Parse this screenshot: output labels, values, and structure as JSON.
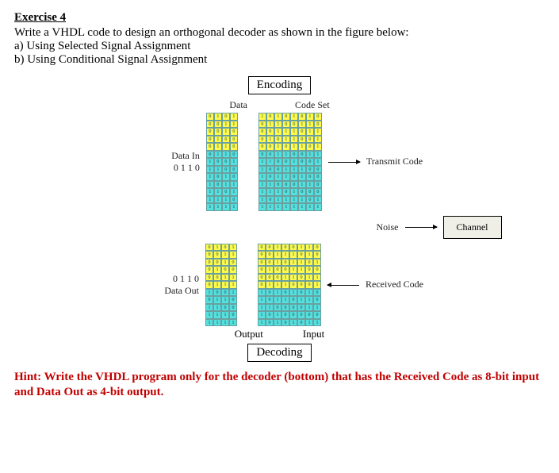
{
  "title": "Exercise 4",
  "prompt": "Write a VHDL code to design an orthogonal decoder as shown in the figure below:",
  "part_a": "a) Using Selected Signal Assignment",
  "part_b": "b) Using Conditional Signal Assignment",
  "figure": {
    "encoding_label": "Encoding",
    "decoding_label": "Decoding",
    "data_header": "Data",
    "codeset_header": "Code Set",
    "data_in_label": "Data In",
    "data_in_value": "0 1 1 0",
    "transmit_label": "Transmit Code",
    "noise_label": "Noise",
    "channel_label": "Channel",
    "data_out_value": "0 1 1 0",
    "data_out_label": "Data Out",
    "received_label": "Received Code",
    "output_label": "Output",
    "input_label": "Input"
  },
  "hint": "Hint: Write the VHDL program only for the decoder (bottom) that has the Received Code as 8-bit input and Data Out as 4-bit output.",
  "encoder": {
    "data_rows": [
      [
        "0",
        "1",
        "0",
        "1"
      ],
      [
        "0",
        "0",
        "1",
        "1"
      ],
      [
        "0",
        "0",
        "1",
        "0"
      ],
      [
        "0",
        "1",
        "0",
        "0"
      ],
      [
        "0",
        "1",
        "1",
        "0"
      ],
      [
        "0",
        "1",
        "1",
        "0"
      ],
      [
        "1",
        "0",
        "0",
        "1"
      ],
      [
        "1",
        "1",
        "0",
        "0"
      ],
      [
        "1",
        "0",
        "1",
        "0"
      ],
      [
        "1",
        "0",
        "1",
        "1"
      ],
      [
        "1",
        "1",
        "0",
        "1"
      ],
      [
        "1",
        "1",
        "1",
        "0"
      ],
      [
        "1",
        "1",
        "1",
        "1"
      ]
    ],
    "code_rows": [
      [
        "1",
        "0",
        "1",
        "0",
        "1",
        "0",
        "1",
        "0"
      ],
      [
        "0",
        "1",
        "1",
        "0",
        "0",
        "1",
        "1",
        "0"
      ],
      [
        "0",
        "0",
        "1",
        "1",
        "1",
        "0",
        "1",
        "1"
      ],
      [
        "0",
        "1",
        "0",
        "1",
        "1",
        "0",
        "0",
        "1"
      ],
      [
        "0",
        "0",
        "1",
        "0",
        "1",
        "1",
        "0",
        "1"
      ],
      [
        "0",
        "0",
        "1",
        "1",
        "0",
        "0",
        "1",
        "1"
      ],
      [
        "1",
        "1",
        "0",
        "0",
        "1",
        "0",
        "0",
        "1"
      ],
      [
        "1",
        "0",
        "0",
        "1",
        "1",
        "1",
        "0",
        "0"
      ],
      [
        "1",
        "0",
        "1",
        "1",
        "0",
        "1",
        "0",
        "0"
      ],
      [
        "1",
        "1",
        "0",
        "0",
        "0",
        "1",
        "1",
        "0"
      ],
      [
        "1",
        "1",
        "1",
        "0",
        "1",
        "0",
        "0",
        "0"
      ],
      [
        "1",
        "0",
        "1",
        "1",
        "1",
        "1",
        "0",
        "1"
      ],
      [
        "1",
        "1",
        "1",
        "1",
        "1",
        "1",
        "1",
        "1"
      ]
    ],
    "data_colors": [
      [
        "y",
        "y",
        "y",
        "y"
      ],
      [
        "y",
        "y",
        "y",
        "y"
      ],
      [
        "y",
        "y",
        "y",
        "y"
      ],
      [
        "y",
        "y",
        "y",
        "y"
      ],
      [
        "y",
        "y",
        "y",
        "y"
      ],
      [
        "c",
        "c",
        "c",
        "c"
      ],
      [
        "c",
        "c",
        "c",
        "c"
      ],
      [
        "c",
        "c",
        "c",
        "c"
      ],
      [
        "c",
        "c",
        "c",
        "c"
      ],
      [
        "c",
        "c",
        "c",
        "c"
      ],
      [
        "c",
        "c",
        "c",
        "c"
      ],
      [
        "c",
        "c",
        "c",
        "c"
      ],
      [
        "c",
        "c",
        "c",
        "c"
      ]
    ],
    "code_colors": [
      [
        "y",
        "y",
        "y",
        "y",
        "y",
        "y",
        "y",
        "y"
      ],
      [
        "y",
        "y",
        "y",
        "y",
        "y",
        "y",
        "y",
        "y"
      ],
      [
        "y",
        "y",
        "y",
        "y",
        "y",
        "y",
        "y",
        "y"
      ],
      [
        "y",
        "y",
        "y",
        "y",
        "y",
        "y",
        "y",
        "y"
      ],
      [
        "y",
        "y",
        "y",
        "y",
        "y",
        "y",
        "y",
        "y"
      ],
      [
        "c",
        "c",
        "c",
        "c",
        "c",
        "c",
        "c",
        "c"
      ],
      [
        "c",
        "c",
        "c",
        "c",
        "c",
        "c",
        "c",
        "c"
      ],
      [
        "c",
        "c",
        "c",
        "c",
        "c",
        "c",
        "c",
        "c"
      ],
      [
        "c",
        "c",
        "c",
        "c",
        "c",
        "c",
        "c",
        "c"
      ],
      [
        "c",
        "c",
        "c",
        "c",
        "c",
        "c",
        "c",
        "c"
      ],
      [
        "c",
        "c",
        "c",
        "c",
        "c",
        "c",
        "c",
        "c"
      ],
      [
        "c",
        "c",
        "c",
        "c",
        "c",
        "c",
        "c",
        "c"
      ],
      [
        "c",
        "c",
        "c",
        "c",
        "c",
        "c",
        "c",
        "c"
      ]
    ]
  },
  "decoder": {
    "data_rows": [
      [
        "0",
        "1",
        "0",
        "1"
      ],
      [
        "0",
        "0",
        "1",
        "1"
      ],
      [
        "0",
        "0",
        "1",
        "0"
      ],
      [
        "0",
        "1",
        "0",
        "0"
      ],
      [
        "0",
        "0",
        "1",
        "1"
      ],
      [
        "0",
        "1",
        "1",
        "1"
      ],
      [
        "1",
        "0",
        "0",
        "1"
      ],
      [
        "0",
        "1",
        "1",
        "0"
      ],
      [
        "1",
        "1",
        "0",
        "0"
      ],
      [
        "1",
        "1",
        "1",
        "0"
      ],
      [
        "1",
        "1",
        "1",
        "1"
      ]
    ],
    "code_rows": [
      [
        "0",
        "0",
        "1",
        "0",
        "0",
        "1",
        "1",
        "0"
      ],
      [
        "0",
        "0",
        "1",
        "1",
        "1",
        "0",
        "1",
        "0"
      ],
      [
        "0",
        "0",
        "1",
        "0",
        "1",
        "1",
        "0",
        "1"
      ],
      [
        "0",
        "1",
        "0",
        "0",
        "1",
        "1",
        "0",
        "0"
      ],
      [
        "0",
        "0",
        "0",
        "1",
        "1",
        "0",
        "1",
        "1"
      ],
      [
        "0",
        "1",
        "1",
        "1",
        "0",
        "0",
        "0",
        "1"
      ],
      [
        "1",
        "0",
        "1",
        "0",
        "1",
        "0",
        "1",
        "0"
      ],
      [
        "1",
        "0",
        "1",
        "1",
        "0",
        "1",
        "1",
        "0"
      ],
      [
        "1",
        "1",
        "0",
        "0",
        "0",
        "0",
        "1",
        "1"
      ],
      [
        "1",
        "0",
        "1",
        "0",
        "0",
        "0",
        "0",
        "0"
      ],
      [
        "1",
        "0",
        "1",
        "0",
        "1",
        "0",
        "1",
        "1"
      ]
    ],
    "data_colors": [
      [
        "y",
        "y",
        "y",
        "y"
      ],
      [
        "y",
        "y",
        "y",
        "y"
      ],
      [
        "y",
        "y",
        "y",
        "y"
      ],
      [
        "y",
        "y",
        "y",
        "y"
      ],
      [
        "y",
        "y",
        "y",
        "y"
      ],
      [
        "y",
        "y",
        "y",
        "y"
      ],
      [
        "c",
        "c",
        "c",
        "c"
      ],
      [
        "c",
        "c",
        "c",
        "c"
      ],
      [
        "c",
        "c",
        "c",
        "c"
      ],
      [
        "c",
        "c",
        "c",
        "c"
      ],
      [
        "c",
        "c",
        "c",
        "c"
      ]
    ],
    "code_colors": [
      [
        "y",
        "y",
        "y",
        "y",
        "y",
        "y",
        "y",
        "y"
      ],
      [
        "y",
        "y",
        "y",
        "y",
        "y",
        "y",
        "y",
        "y"
      ],
      [
        "y",
        "y",
        "y",
        "y",
        "y",
        "y",
        "y",
        "y"
      ],
      [
        "y",
        "y",
        "y",
        "y",
        "y",
        "y",
        "y",
        "y"
      ],
      [
        "y",
        "y",
        "y",
        "y",
        "y",
        "y",
        "y",
        "y"
      ],
      [
        "y",
        "y",
        "y",
        "y",
        "y",
        "y",
        "y",
        "y"
      ],
      [
        "c",
        "c",
        "c",
        "c",
        "c",
        "c",
        "c",
        "c"
      ],
      [
        "c",
        "c",
        "c",
        "c",
        "c",
        "c",
        "c",
        "c"
      ],
      [
        "c",
        "c",
        "c",
        "c",
        "c",
        "c",
        "c",
        "c"
      ],
      [
        "c",
        "c",
        "c",
        "c",
        "c",
        "c",
        "c",
        "c"
      ],
      [
        "c",
        "c",
        "c",
        "c",
        "c",
        "c",
        "c",
        "c"
      ]
    ]
  }
}
